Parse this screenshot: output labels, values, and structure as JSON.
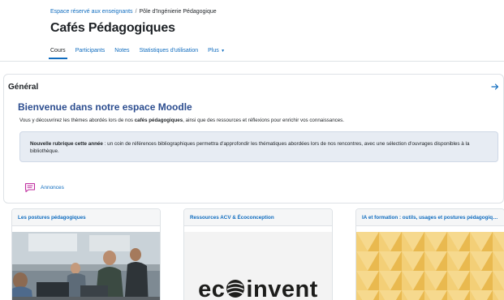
{
  "breadcrumb": {
    "parent": "Espace réservé aux enseignants",
    "separator": "/",
    "current": "Pôle d'Ingénierie Pédagogique"
  },
  "page_title": "Cafés Pédagogiques",
  "tabs": [
    {
      "label": "Cours",
      "active": true
    },
    {
      "label": "Participants",
      "active": false
    },
    {
      "label": "Notes",
      "active": false
    },
    {
      "label": "Statistiques d'utilisation",
      "active": false
    },
    {
      "label": "Plus",
      "active": false,
      "icon": "chevron-down-icon"
    }
  ],
  "section": {
    "title": "Général",
    "arrow_icon": "arrow-right-icon",
    "welcome": "Bienvenue dans notre espace Moodle",
    "intro_before": "Vous y découvrirez les thèmes abordés lors de nos ",
    "intro_bold": "cafés pédagogiques",
    "intro_after": ", ainsi que des ressources et réflexions pour enrichir vos connaissances.",
    "note_bold": "Nouvelle rubrique cette année",
    "note_text": " : un coin de références bibliographiques permettra d'approfondir les thématiques abordées lors de nos rencontres, avec une sélection d'ouvrages disponibles à la bibliothèque.",
    "announce_label": "Annonces",
    "announce_icon": "forum-icon"
  },
  "cards": [
    {
      "title": "Les postures pédagogiques"
    },
    {
      "title": "Ressources ACV & Écoconception",
      "logo_before": "ec",
      "logo_after": "invent"
    },
    {
      "title": "IA et formation : outils, usages et postures pédagogiques"
    }
  ],
  "colors": {
    "link": "#0f6cbf",
    "welcome": "#2c4d8f",
    "note_bg": "#e7ecf3",
    "announce_icon": "#c02e9f"
  }
}
